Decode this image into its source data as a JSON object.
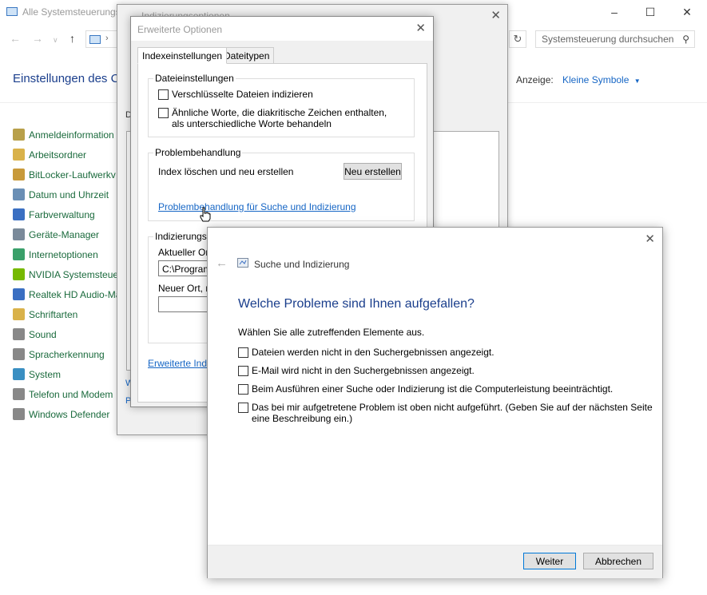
{
  "control_panel": {
    "window_title": "Alle Systemsteuerungs",
    "search_placeholder": "Systemsteuerung durchsuchen",
    "heading": "Einstellungen des C",
    "view_label": "Anzeige:",
    "view_value": "Kleine Symbole",
    "items": [
      {
        "label": "Anmeldeinformation",
        "icon": "credential-icon",
        "color": "#b8a04a"
      },
      {
        "label": "Arbeitsordner",
        "icon": "work-folders-icon",
        "color": "#d9b24a"
      },
      {
        "label": "BitLocker-Laufwerkv",
        "icon": "bitlocker-icon",
        "color": "#c89a3a"
      },
      {
        "label": "Datum und Uhrzeit",
        "icon": "clock-icon",
        "color": "#6a8fb5"
      },
      {
        "label": "Farbverwaltung",
        "icon": "color-management-icon",
        "color": "#3a6fc2"
      },
      {
        "label": "Geräte-Manager",
        "icon": "device-manager-icon",
        "color": "#7a8a9a"
      },
      {
        "label": "Internetoptionen",
        "icon": "internet-options-icon",
        "color": "#3aa06a"
      },
      {
        "label": "NVIDIA Systemsteuer",
        "icon": "nvidia-icon",
        "color": "#76b900"
      },
      {
        "label": "Realtek HD Audio-Ma",
        "icon": "realtek-icon",
        "color": "#3a6fc2"
      },
      {
        "label": "Schriftarten",
        "icon": "fonts-icon",
        "color": "#d9b24a"
      },
      {
        "label": "Sound",
        "icon": "sound-icon",
        "color": "#888888"
      },
      {
        "label": "Spracherkennung",
        "icon": "microphone-icon",
        "color": "#888888"
      },
      {
        "label": "System",
        "icon": "system-icon",
        "color": "#3a8fc2"
      },
      {
        "label": "Telefon und Modem",
        "icon": "phone-modem-icon",
        "color": "#888888"
      },
      {
        "label": "Windows Defender",
        "icon": "defender-icon",
        "color": "#888888"
      }
    ]
  },
  "indexing_dialog": {
    "title": "Indizierungsoptionen",
    "small_label": "D",
    "link_w": "W",
    "link_p": "P"
  },
  "advanced_dialog": {
    "title": "Erweiterte Optionen",
    "tabs": [
      "Indexeinstellungen",
      "Dateitypen"
    ],
    "file_settings": {
      "legend": "Dateieinstellungen",
      "encrypt_label": "Verschlüsselte Dateien indizieren",
      "diacritic_label": "Ähnliche Worte, die diakritische Zeichen enthalten, als unterschiedliche Worte behandeln"
    },
    "troubleshooting": {
      "legend": "Problembehandlung",
      "rebuild_text": "Index löschen und neu erstellen",
      "rebuild_button": "Neu erstellen",
      "link": "Problembehandlung für Suche und Indizierung"
    },
    "location": {
      "legend": "Indizierungsor",
      "current_label": "Aktueller Ort:",
      "current_value": "C:\\ProgramD",
      "new_label": "Neuer Ort, na"
    },
    "bottom_link": "Erweiterte Indiz"
  },
  "wizard": {
    "title": "Suche und Indizierung",
    "question": "Welche Probleme sind Ihnen aufgefallen?",
    "subtitle": "Wählen Sie alle zutreffenden Elemente aus.",
    "options": [
      "Dateien werden nicht in den Suchergebnissen angezeigt.",
      "E-Mail wird nicht in den Suchergebnissen angezeigt.",
      "Beim Ausführen einer Suche oder Indizierung ist die Computerleistung beeinträchtigt.",
      "Das bei mir aufgetretene Problem ist oben nicht aufgeführt. (Geben Sie auf der nächsten Seite eine Beschreibung ein.)"
    ],
    "next_button": "Weiter",
    "cancel_button": "Abbrechen"
  }
}
